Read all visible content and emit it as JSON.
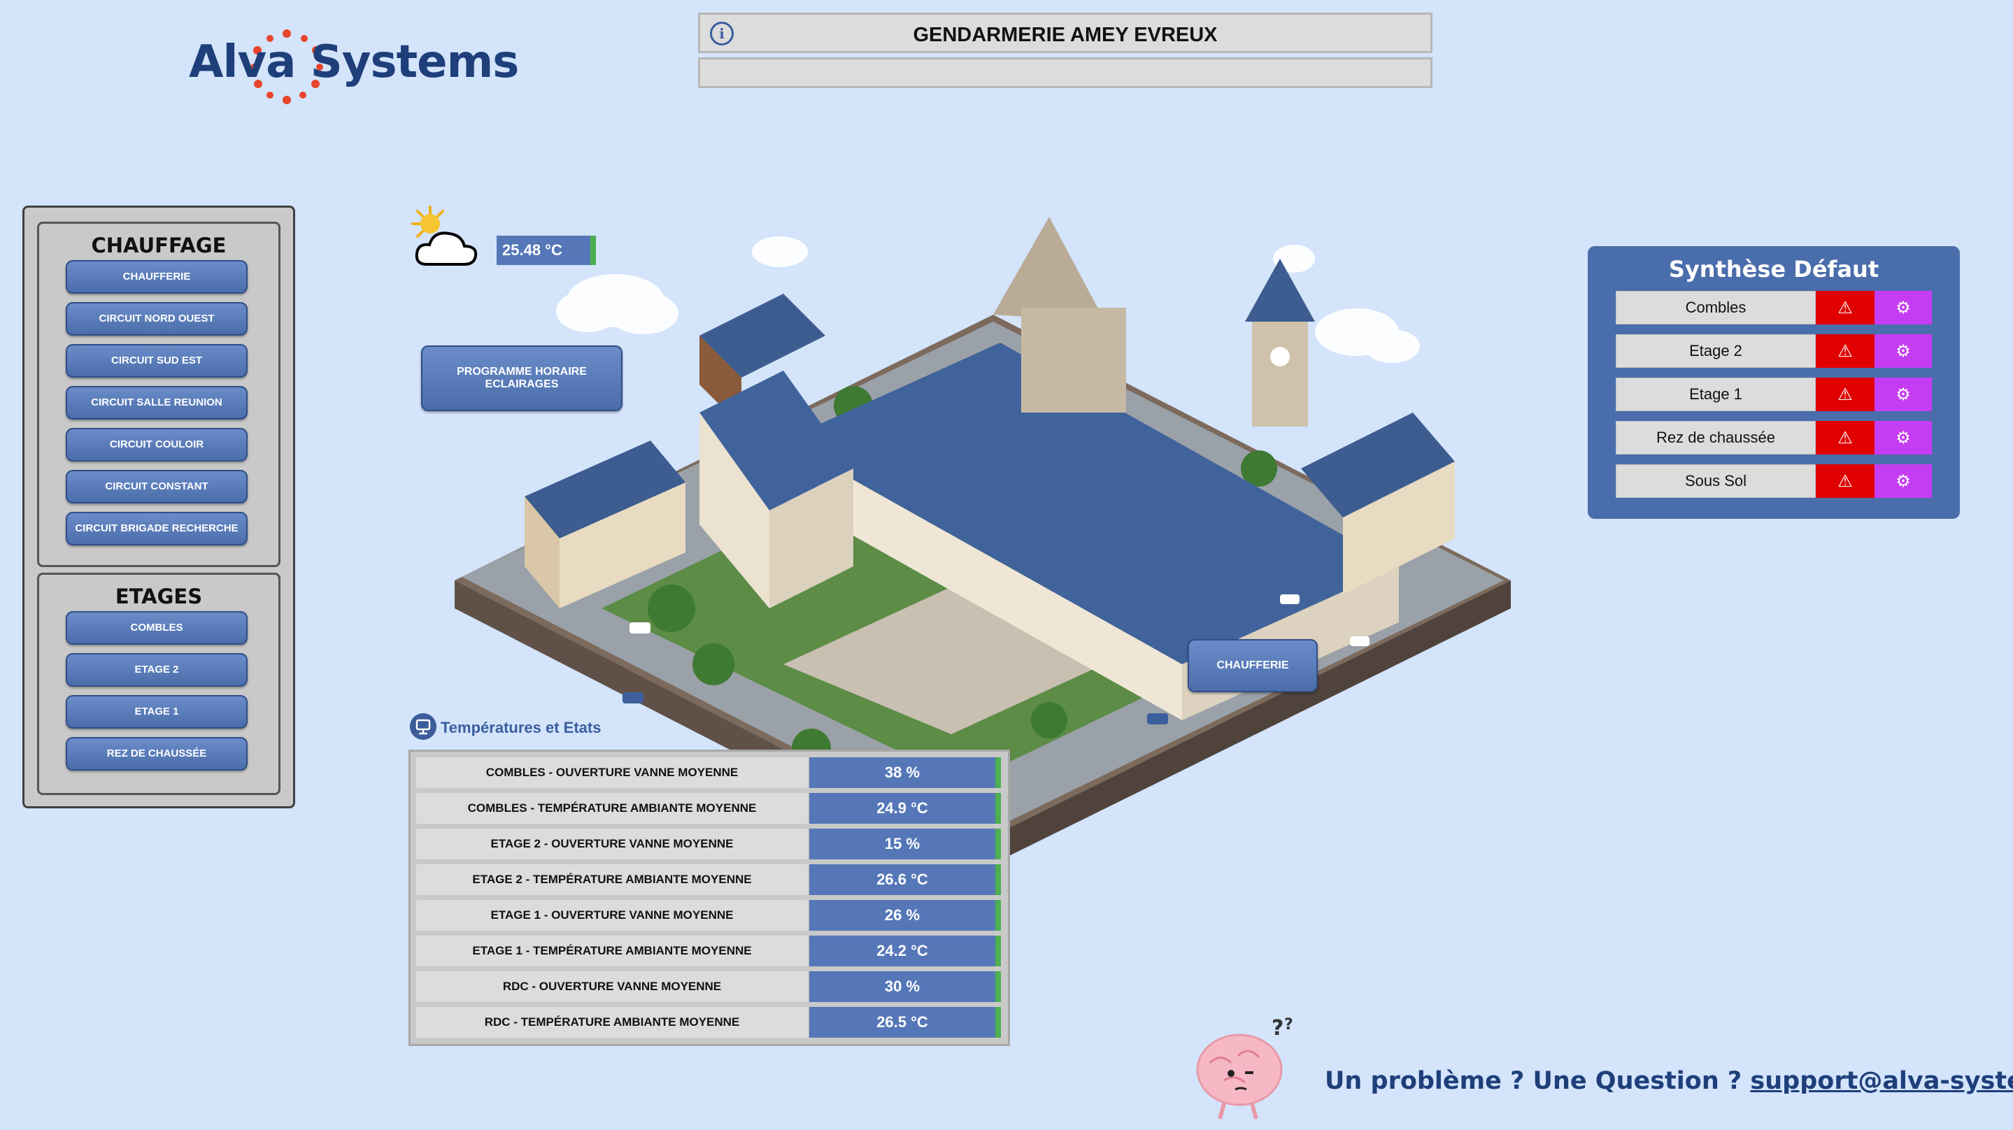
{
  "logo": {
    "text": "Alva Systems",
    "accent": "#e8452c"
  },
  "header": {
    "title": "GENDARMERIE AMEY EVREUX",
    "subtitle": ""
  },
  "weather": {
    "temperature": "25.48 °C",
    "icon": "sun-cloud-icon"
  },
  "chauffage": {
    "title": "CHAUFFAGE",
    "buttons": [
      "CHAUFFERIE",
      "CIRCUIT NORD OUEST",
      "CIRCUIT SUD EST",
      "CIRCUIT SALLE REUNION",
      "CIRCUIT COULOIR",
      "CIRCUIT CONSTANT",
      "CIRCUIT BRIGADE RECHERCHE"
    ]
  },
  "etages": {
    "title": "ETAGES",
    "buttons": [
      "COMBLES",
      "ETAGE 2",
      "ETAGE 1",
      "REZ DE CHAUSSÉE"
    ]
  },
  "scene": {
    "program_button": "PROGRAMME HORAIRE ECLAIRAGES",
    "chaufferie_button": "CHAUFFERIE"
  },
  "synthese": {
    "title": "Synthèse Défaut",
    "rows": [
      {
        "label": "Combles",
        "alert_icon": "warning-icon",
        "settings_icon": "gear-icon"
      },
      {
        "label": "Etage 2",
        "alert_icon": "warning-icon",
        "settings_icon": "gear-icon"
      },
      {
        "label": "Etage 1",
        "alert_icon": "warning-icon",
        "settings_icon": "gear-icon"
      },
      {
        "label": "Rez de chaussée",
        "alert_icon": "warning-icon",
        "settings_icon": "gear-icon"
      },
      {
        "label": "Sous Sol",
        "alert_icon": "warning-icon",
        "settings_icon": "gear-icon"
      }
    ],
    "colors": {
      "panel": "#4a6dab",
      "alert": "#e00000",
      "settings": "#c53df2"
    }
  },
  "temperatures": {
    "title": "Températures et Etats",
    "rows": [
      {
        "label": "COMBLES - OUVERTURE VANNE MOYENNE",
        "value": "38 %"
      },
      {
        "label": "COMBLES - TEMPÉRATURE AMBIANTE MOYENNE",
        "value": "24.9 °C"
      },
      {
        "label": "ETAGE 2 - OUVERTURE VANNE MOYENNE",
        "value": "15 %"
      },
      {
        "label": "ETAGE 2 - TEMPÉRATURE AMBIANTE MOYENNE",
        "value": "26.6 °C"
      },
      {
        "label": "ETAGE 1 - OUVERTURE VANNE MOYENNE",
        "value": "26 %"
      },
      {
        "label": "ETAGE 1 - TEMPÉRATURE AMBIANTE MOYENNE",
        "value": "24.2 °C"
      },
      {
        "label": "RDC - OUVERTURE VANNE MOYENNE",
        "value": "30 %"
      },
      {
        "label": "RDC - TEMPÉRATURE AMBIANTE MOYENNE",
        "value": "26.5 °C"
      }
    ]
  },
  "support": {
    "question": "Un problème ? Une Question ? ",
    "email": "support@alva-systems.fr"
  }
}
